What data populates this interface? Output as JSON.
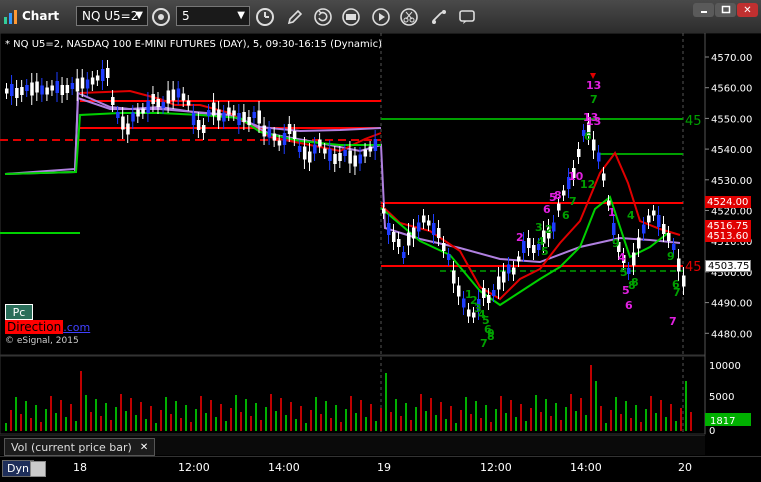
{
  "titlebar": {
    "chart_label": "Chart",
    "symbol": "NQ U5=2",
    "interval": "5",
    "close_glyph": "✕"
  },
  "chart_title": "* NQ U5=2, NASDAQ 100 E-MINI FUTURES (DAY), 5, 09:30-16:15 (Dynamic)",
  "price_axis": {
    "ticks": [
      "4570.00",
      "4560.00",
      "4550.00",
      "4540.00",
      "4530.00",
      "4520.00",
      "4510.00",
      "4500.00",
      "4490.00",
      "4480.00"
    ],
    "boxes": [
      {
        "label": "4524.00",
        "color": "#e00000"
      },
      {
        "label": "4516.75",
        "color": "#e00000"
      },
      {
        "label": "4513.60",
        "color": "#e00000"
      },
      {
        "label": "4503.75",
        "color": "#ffffff"
      }
    ]
  },
  "level_labels": {
    "upper": "45",
    "lower": "45"
  },
  "td_counts": {
    "top_marker": "13",
    "labels": [
      "7",
      "13",
      "6",
      "10",
      "5",
      "8",
      "6",
      "2",
      "1",
      "2",
      "3",
      "4",
      "5",
      "6",
      "7",
      "8",
      "9",
      "4",
      "5",
      "6",
      "7",
      "1",
      "2",
      "3",
      "4",
      "5",
      "6",
      "7",
      "8",
      "9",
      "13",
      "12",
      "8",
      "9",
      "4",
      "7",
      "6",
      "5"
    ]
  },
  "watermark": {
    "pc": "Pc",
    "brand": "Direction",
    "suffix": ".com",
    "copyright": "© eSignal, 2015"
  },
  "volume_axis": {
    "ticks": [
      "10000",
      "5000",
      "0"
    ],
    "current": "1817"
  },
  "volume_tab": {
    "label": "Vol (current price bar)",
    "close": "✕"
  },
  "time_axis": {
    "dyn_label": "Dyn",
    "labels": [
      "18",
      "12:00",
      "14:00",
      "19",
      "12:00",
      "14:00",
      "20"
    ]
  },
  "colors": {
    "up_candle": "#ffffff",
    "down_candle": "#1e3cff",
    "green_ma": "#00d000",
    "red_ma": "#e00000",
    "purple_ma": "#b080e0",
    "resistance": "#ff0000",
    "support_green": "#00a000",
    "vol_up": "#00b000",
    "vol_down": "#c00000"
  }
}
